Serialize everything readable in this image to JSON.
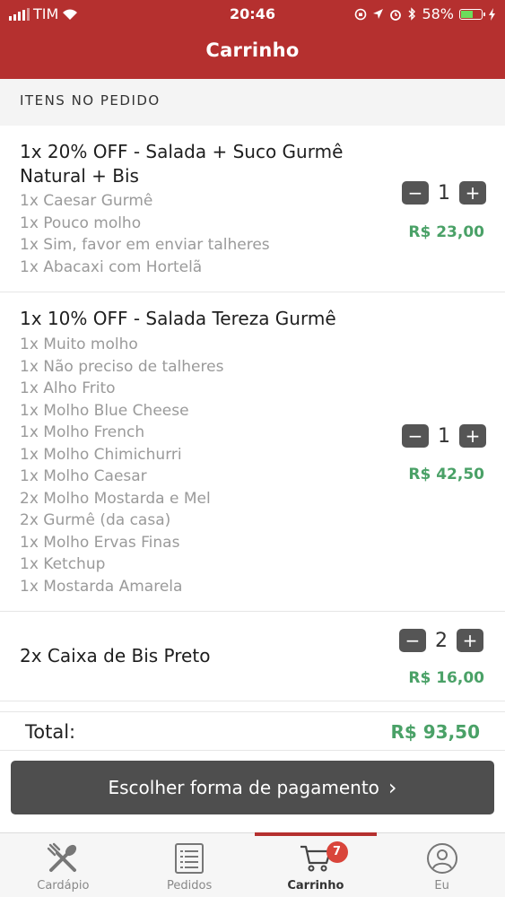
{
  "status_bar": {
    "carrier": "TIM",
    "time": "20:46",
    "battery": "58%",
    "battery_level": 0.58
  },
  "header": {
    "title": "Carrinho"
  },
  "section_label": "ITENS NO PEDIDO",
  "items": [
    {
      "name": "1x 20% OFF - Salada + Suco Gurmê Natural + Bis",
      "options": [
        "1x Caesar Gurmê",
        "1x Pouco molho",
        "1x Sim, favor em enviar talheres",
        "1x Abacaxi com Hortelã"
      ],
      "quantity": "1",
      "price": "R$ 23,00"
    },
    {
      "name": "1x 10% OFF - Salada Tereza Gurmê",
      "options": [
        "1x Muito molho",
        "1x Não preciso de talheres",
        "1x Alho Frito",
        "1x Molho Blue Cheese",
        "1x Molho French",
        "1x Molho Chimichurri",
        "1x Molho Caesar",
        "2x Molho Mostarda e Mel",
        "2x Gurmê (da casa)",
        "1x Molho Ervas Finas",
        "1x Ketchup",
        "1x Mostarda Amarela"
      ],
      "quantity": "1",
      "price": "R$ 42,50"
    },
    {
      "name": "2x Caixa de Bis Preto",
      "options": [],
      "quantity": "2",
      "price": "R$ 16,00"
    }
  ],
  "stepper": {
    "minus": "−",
    "plus": "+"
  },
  "total": {
    "label": "Total:",
    "value": "R$ 93,50"
  },
  "pay_button": {
    "label": "Escolher forma de pagamento",
    "chevron": "›"
  },
  "tabs": [
    {
      "label": "Cardápio",
      "icon": "cutlery-icon",
      "active": false
    },
    {
      "label": "Pedidos",
      "icon": "list-icon",
      "active": false
    },
    {
      "label": "Carrinho",
      "icon": "cart-icon",
      "active": true,
      "badge": "7"
    },
    {
      "label": "Eu",
      "icon": "user-icon",
      "active": false
    }
  ],
  "colors": {
    "brand": "#b5302f",
    "price": "#4aa167",
    "badge": "#d9453b",
    "button": "#4e4e4e"
  }
}
